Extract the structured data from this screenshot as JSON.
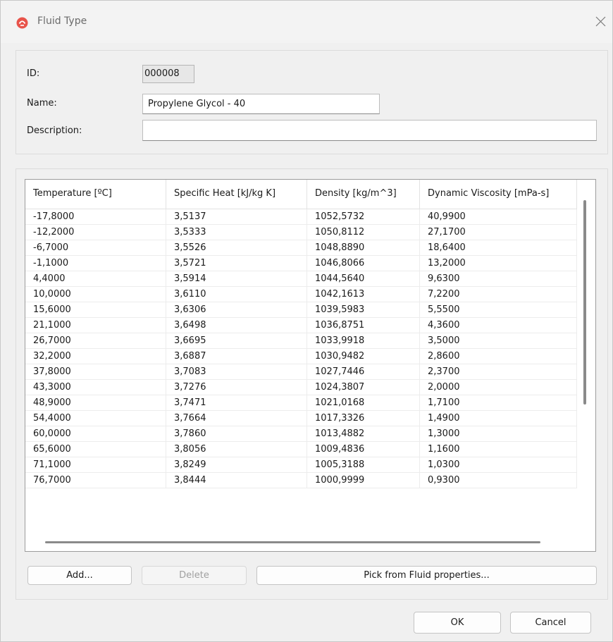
{
  "window": {
    "title": "Fluid Type",
    "app_icon": "fluid-app-icon",
    "close_icon": "close-icon"
  },
  "form": {
    "id_label": "ID:",
    "id_value": "000008",
    "name_label": "Name:",
    "name_value": "Propylene Glycol - 40",
    "description_label": "Description:",
    "description_value": ""
  },
  "table": {
    "columns": [
      "Temperature [ºC]",
      "Specific Heat [kJ/kg K]",
      "Density [kg/m^3]",
      "Dynamic Viscosity [mPa-s]"
    ],
    "rows": [
      [
        "-17,8000",
        "3,5137",
        "1052,5732",
        "40,9900"
      ],
      [
        "-12,2000",
        "3,5333",
        "1050,8112",
        "27,1700"
      ],
      [
        "-6,7000",
        "3,5526",
        "1048,8890",
        "18,6400"
      ],
      [
        "-1,1000",
        "3,5721",
        "1046,8066",
        "13,2000"
      ],
      [
        "4,4000",
        "3,5914",
        "1044,5640",
        "9,6300"
      ],
      [
        "10,0000",
        "3,6110",
        "1042,1613",
        "7,2200"
      ],
      [
        "15,6000",
        "3,6306",
        "1039,5983",
        "5,5500"
      ],
      [
        "21,1000",
        "3,6498",
        "1036,8751",
        "4,3600"
      ],
      [
        "26,7000",
        "3,6695",
        "1033,9918",
        "3,5000"
      ],
      [
        "32,2000",
        "3,6887",
        "1030,9482",
        "2,8600"
      ],
      [
        "37,8000",
        "3,7083",
        "1027,7446",
        "2,3700"
      ],
      [
        "43,3000",
        "3,7276",
        "1024,3807",
        "2,0000"
      ],
      [
        "48,9000",
        "3,7471",
        "1021,0168",
        "1,7100"
      ],
      [
        "54,4000",
        "3,7664",
        "1017,3326",
        "1,4900"
      ],
      [
        "60,0000",
        "3,7860",
        "1013,4882",
        "1,3000"
      ],
      [
        "65,6000",
        "3,8056",
        "1009,4836",
        "1,1600"
      ],
      [
        "71,1000",
        "3,8249",
        "1005,3188",
        "1,0300"
      ],
      [
        "76,7000",
        "3,8444",
        "1000,9999",
        "0,9300"
      ]
    ]
  },
  "buttons": {
    "add": "Add...",
    "delete": "Delete",
    "pick": "Pick from Fluid properties...",
    "ok": "OK",
    "cancel": "Cancel"
  }
}
